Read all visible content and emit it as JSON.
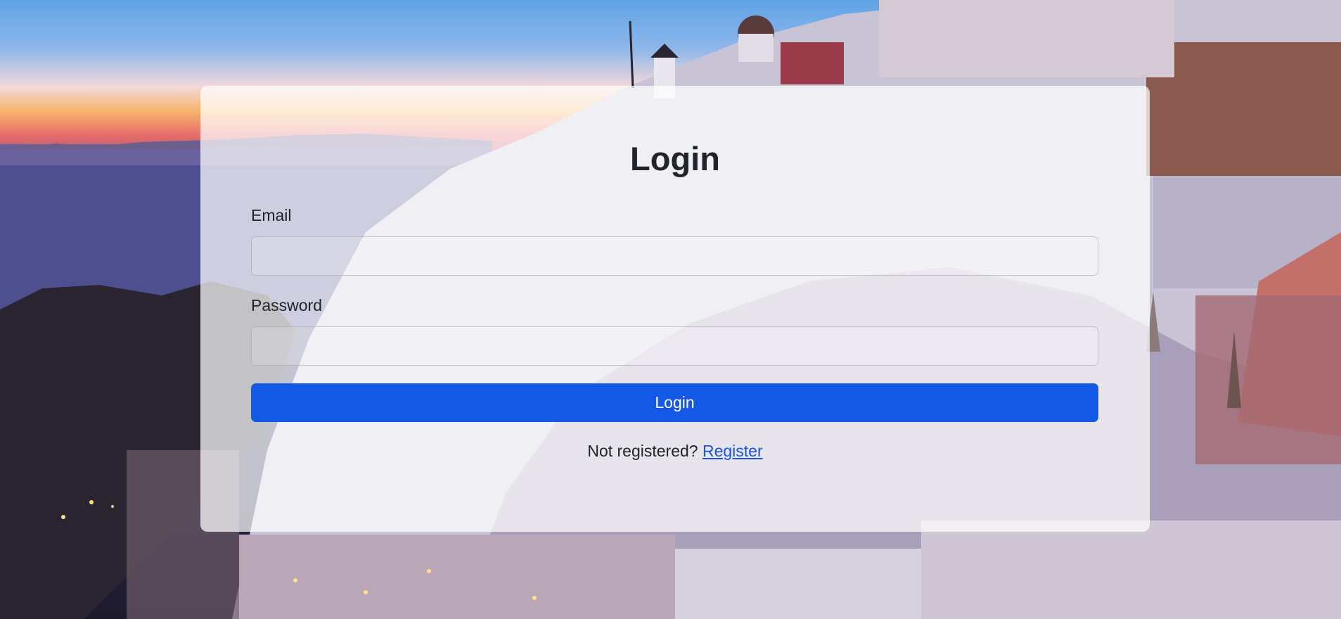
{
  "login_form": {
    "title": "Login",
    "email_label": "Email",
    "email_value": "",
    "password_label": "Password",
    "password_value": "",
    "submit_label": "Login",
    "register_prompt": "Not registered?",
    "register_link": "Register"
  },
  "colors": {
    "primary_button": "#1459e6",
    "link": "#1a56db",
    "text": "#212529",
    "card_background": "rgba(255,255,255,0.72)"
  }
}
